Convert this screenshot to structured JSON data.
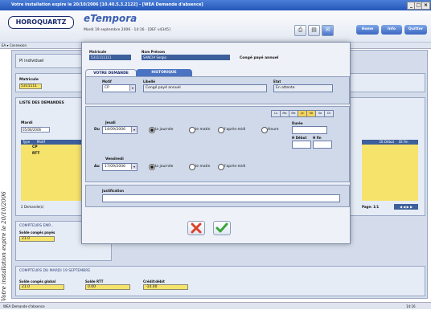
{
  "window": {
    "title": "Votre installation expire le 20/10/2006 [10.40.5.3.2122] - [WEA Demande d'absence]"
  },
  "header": {
    "logo": "HOROQUARTZ",
    "brand": "eTempora",
    "date": "Mardi 19 septembre 2006 · 14:16 · [DEF v4345]",
    "btn_home": "Home",
    "btn_info": "Info",
    "btn_quit": "Quitter"
  },
  "menubar": {
    "left": "EA ▾ Connexion",
    "mid": "▾"
  },
  "sidetext": "Votre installation expire le 20/10/2006",
  "page": {
    "pi_label": "PI individuel",
    "matricule_label": "Matricule",
    "matricule_value": "5311111",
    "list_title": "LISTE DES DEMANDES",
    "month_label": "Mardi",
    "month_value": "05/06/2006",
    "col_type": "Type",
    "col_motif": "Motif",
    "col_debut": "Dt Début",
    "col_fin": "Dt Fin",
    "row1": "CP",
    "row2": "RTT",
    "demands_count": "2 Demande(s)",
    "pager": "Page: 1/1",
    "compteurs_today": "COMPTEURS EMP...",
    "solde_cp": "Solde congés payés",
    "solde_cp_val": "21.0",
    "compteurs_title": "COMPTEURS DU MARDI 19 SEPTEMBRE",
    "c1_label": "Solde congés global",
    "c1_val": "21.0",
    "c2_label": "Solde RTT",
    "c2_val": "0.00",
    "c3_label": "Crédit/débit",
    "c3_val": "-14.00"
  },
  "modal": {
    "matricule_label": "Matricule",
    "matricule_value": "5311111111",
    "name_label": "Nom Prénom",
    "name_value": "SANCIA Sergio",
    "absence_type": "Congé payé annuel",
    "tab_demande": "VOTRE DEMANDE",
    "tab_historique": "HISTORIQUE",
    "motif_label": "Motif",
    "motif_value": "CP",
    "libelle_label": "Libellé",
    "libelle_value": "Congé payé annuel",
    "etat_label": "Etat",
    "etat_value": "En attente",
    "days": [
      "Lu",
      "Ma",
      "Me",
      "Je",
      "Ve",
      "Sa",
      "Di"
    ],
    "from_day": "Jeudi",
    "du_label": "Du",
    "from_date": "14/09/2006",
    "r_journee": "la journée",
    "r_matin": "le matin",
    "r_aprem": "l'après-midi",
    "r_heure": "Heure",
    "duree_label": "Durée",
    "hdebut_label": "H Début",
    "hfin_label": "H fin",
    "to_day": "Vendredi",
    "au_label": "Au",
    "to_date": "17/09/2006",
    "just_label": "Justification"
  },
  "statusbar": {
    "left": "WEA Demande d'absence",
    "right": "14:16"
  }
}
